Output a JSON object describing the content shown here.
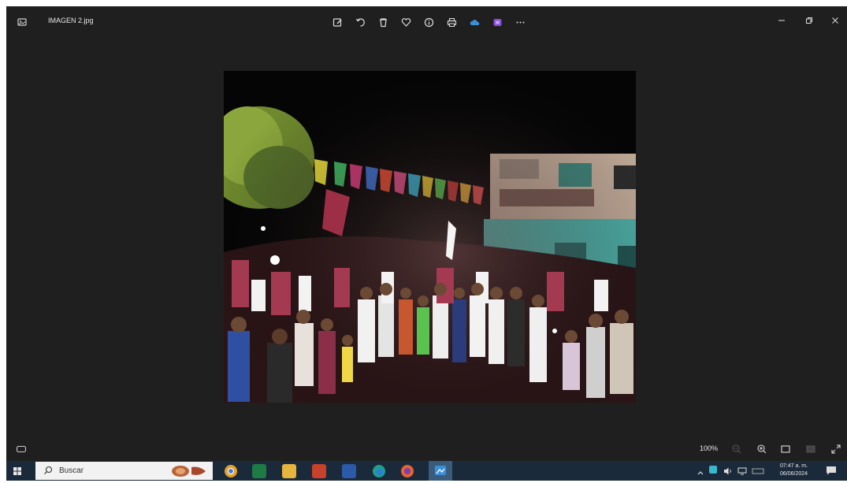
{
  "window": {
    "title": "IMAGEN 2.jpg",
    "toolbar": [
      {
        "icon": "edit-image-icon"
      },
      {
        "icon": "rotate-icon"
      },
      {
        "icon": "delete-icon"
      },
      {
        "icon": "favorite-heart-icon"
      },
      {
        "icon": "info-icon"
      },
      {
        "icon": "print-icon"
      },
      {
        "icon": "onedrive-cloud-icon"
      },
      {
        "icon": "clipchamp-icon"
      },
      {
        "icon": "more-options-icon"
      }
    ]
  },
  "viewer": {
    "zoom_label": "100%"
  },
  "taskbar": {
    "search_placeholder": "Buscar",
    "time": "07:47 a. m.",
    "date": "06/06/2024"
  },
  "colors": {
    "window_bg": "#1f1f1f",
    "taskbar_bg": "#1b2a3a",
    "accent_blue": "#3b8fd9"
  }
}
